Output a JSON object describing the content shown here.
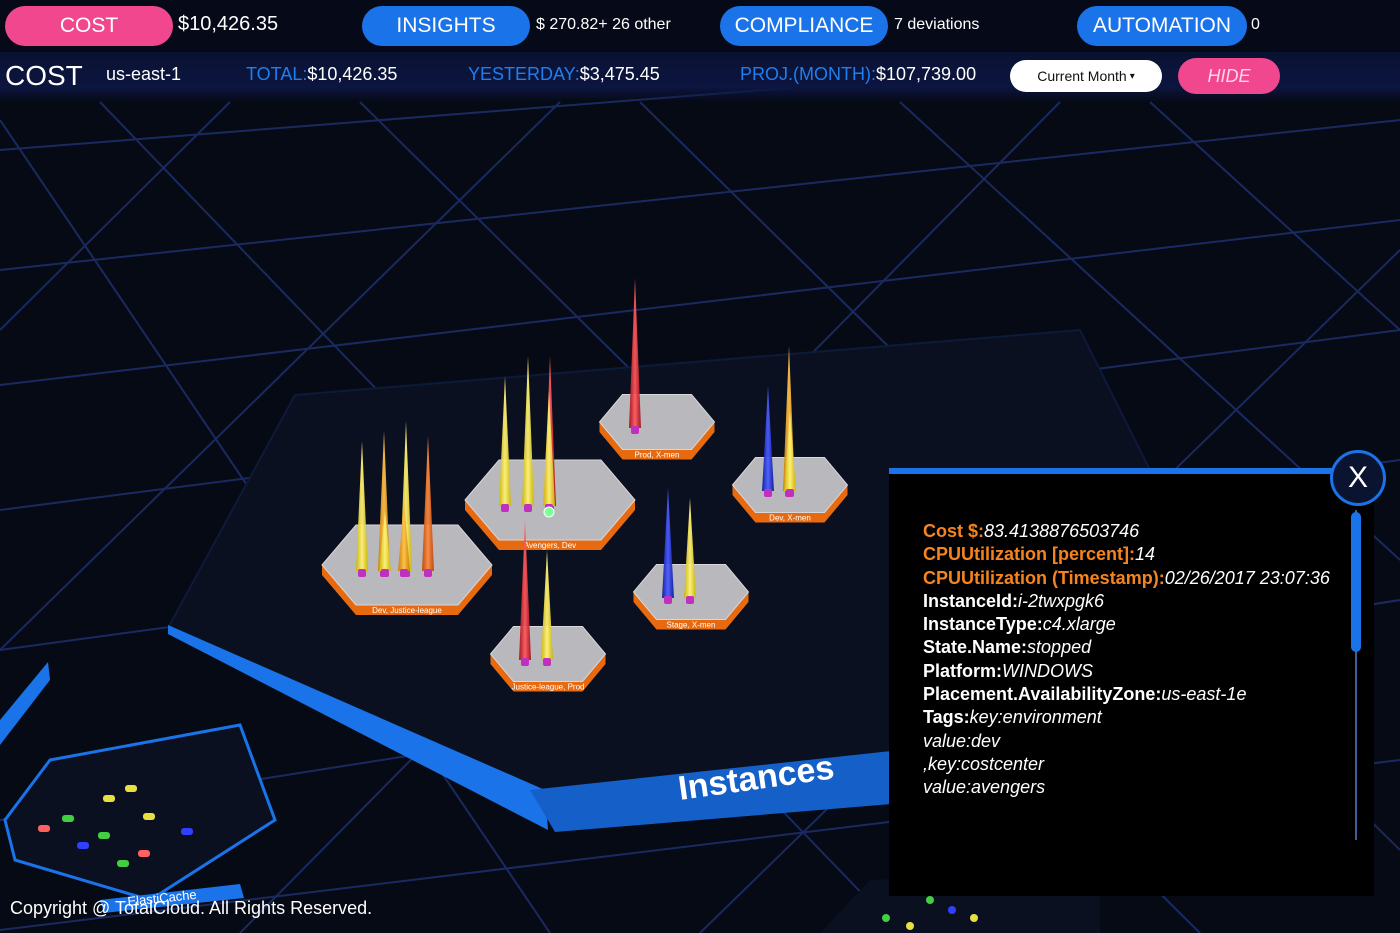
{
  "header": {
    "tabs": [
      {
        "label": "COST",
        "value": "$10,426.35"
      },
      {
        "label": "INSIGHTS",
        "value": "$ 270.82+ 26 other"
      },
      {
        "label": "COMPLIANCE",
        "value": "7 deviations"
      },
      {
        "label": "AUTOMATION",
        "value": "0"
      }
    ]
  },
  "cost_bar": {
    "title": "COST",
    "region": "us-east-1",
    "total_label": "TOTAL:",
    "total_value": "$10,426.35",
    "yesterday_label": "YESTERDAY:",
    "yesterday_value": "$3,475.45",
    "proj_label": "PROJ.(MONTH):",
    "proj_value": "$107,739.00",
    "period_select": "Current Month",
    "hide_label": "HIDE"
  },
  "scene": {
    "group_label": "Instances",
    "service_label": "ElastiCache",
    "hexes": [
      {
        "label": "Dev, Justice-league"
      },
      {
        "label": "Avengers, Dev"
      },
      {
        "label": "Prod, X-men"
      },
      {
        "label": "Dev, X-men"
      },
      {
        "label": "Stage, X-men"
      },
      {
        "label": "Justice-league, Prod"
      }
    ]
  },
  "details": {
    "close_label": "X",
    "cost_label": "Cost $:",
    "cost_value": "83.4138876503746",
    "cpu_label": "CPUUtilization [percent]:",
    "cpu_value": "14",
    "ts_label": "CPUUtilization (Timestamp):",
    "ts_value": "02/26/2017 23:07:36",
    "instance_id_label": "InstanceId:",
    "instance_id_value": "i-2twxpgk6",
    "instance_type_label": "InstanceType:",
    "instance_type_value": "c4.xlarge",
    "state_label": "State.Name:",
    "state_value": "stopped",
    "platform_label": "Platform:",
    "platform_value": "WINDOWS",
    "az_label": "Placement.AvailabilityZone:",
    "az_value": "us-east-1e",
    "tags_label": "Tags:",
    "tags_line1": "key:environment",
    "tags_line2": "value:dev",
    "tags_line3": ",key:costcenter",
    "tags_line4": "value:avengers"
  },
  "footer": {
    "copyright": "Copyright @ TotalCloud. All Rights Reserved."
  },
  "colors": {
    "accent_blue": "#1a73e8",
    "accent_pink": "#f0478e",
    "label_orange": "#f5841f",
    "background": "#060a14"
  }
}
